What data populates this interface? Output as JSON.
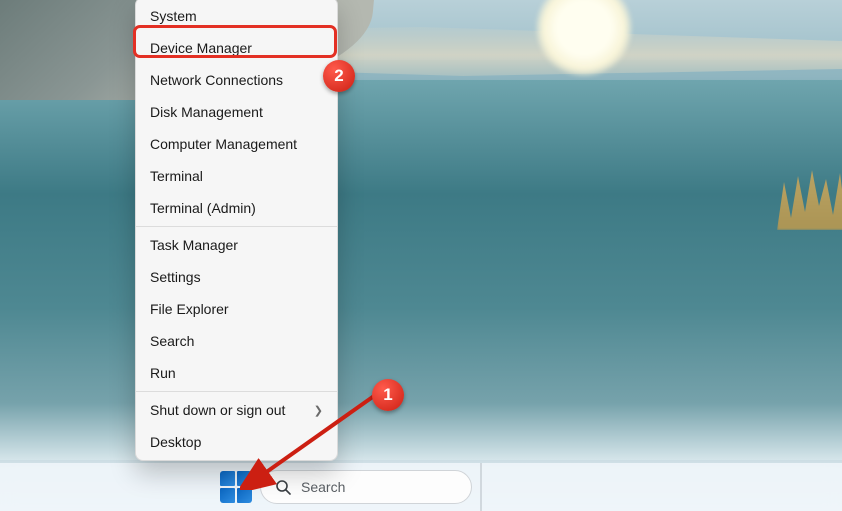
{
  "menu": {
    "items": [
      "System",
      "Device Manager",
      "Network Connections",
      "Disk Management",
      "Computer Management",
      "Terminal",
      "Terminal (Admin)",
      "Task Manager",
      "Settings",
      "File Explorer",
      "Search",
      "Run",
      "Shut down or sign out",
      "Desktop"
    ]
  },
  "taskbar": {
    "search_placeholder": "Search"
  },
  "annotations": {
    "step1": "1",
    "step2": "2"
  }
}
